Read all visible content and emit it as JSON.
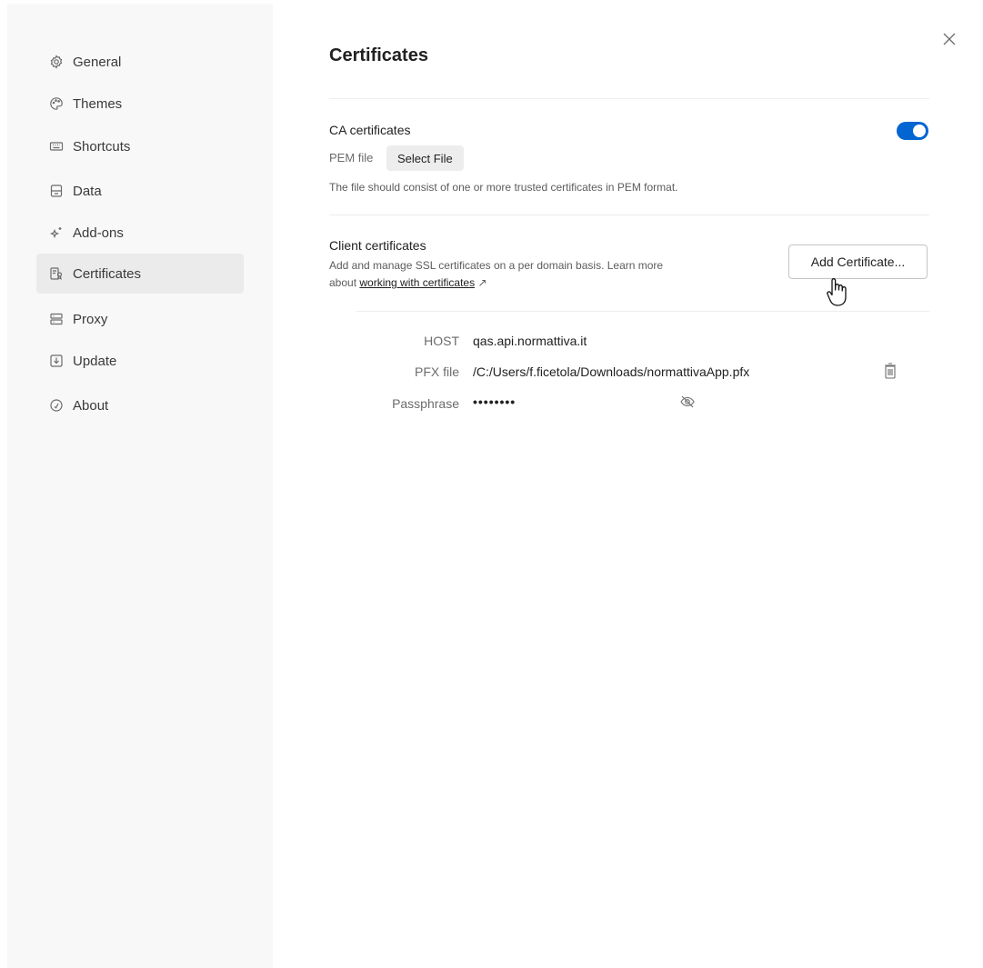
{
  "sidebar": {
    "items": [
      {
        "label": "General",
        "icon": "gear-icon",
        "active": false
      },
      {
        "label": "Themes",
        "icon": "palette-icon",
        "active": false
      },
      {
        "label": "Shortcuts",
        "icon": "keyboard-icon",
        "active": false
      },
      {
        "label": "Data",
        "icon": "database-icon",
        "active": false
      },
      {
        "label": "Add-ons",
        "icon": "sparkle-icon",
        "active": false
      },
      {
        "label": "Certificates",
        "icon": "certificate-icon",
        "active": true
      },
      {
        "label": "Proxy",
        "icon": "proxy-icon",
        "active": false
      },
      {
        "label": "Update",
        "icon": "download-icon",
        "active": false
      },
      {
        "label": "About",
        "icon": "info-icon",
        "active": false
      }
    ]
  },
  "main": {
    "title": "Certificates",
    "ca": {
      "label": "CA certificates",
      "enabled": true,
      "pem_label": "PEM file",
      "select_file": "Select File",
      "help": "The file should consist of one or more trusted certificates in PEM format."
    },
    "client": {
      "label": "Client certificates",
      "description_line1": "Add and manage SSL certificates on a per domain basis. Learn more",
      "description_prefix": "about ",
      "link_text": "working with certificates",
      "link_arrow": "↗",
      "add_button": "Add Certificate..."
    },
    "certificate": {
      "host_label": "HOST",
      "host_value": "qas.api.normattiva.it",
      "pfx_label": "PFX file",
      "pfx_value": "/C:/Users/f.ficetola/Downloads/normattivaApp.pfx",
      "pass_label": "Passphrase",
      "pass_value": "••••••••"
    }
  },
  "colors": {
    "accent": "#0265d2",
    "sidebar_bg": "#f8f8f8",
    "active_item_bg": "#ebebeb"
  }
}
